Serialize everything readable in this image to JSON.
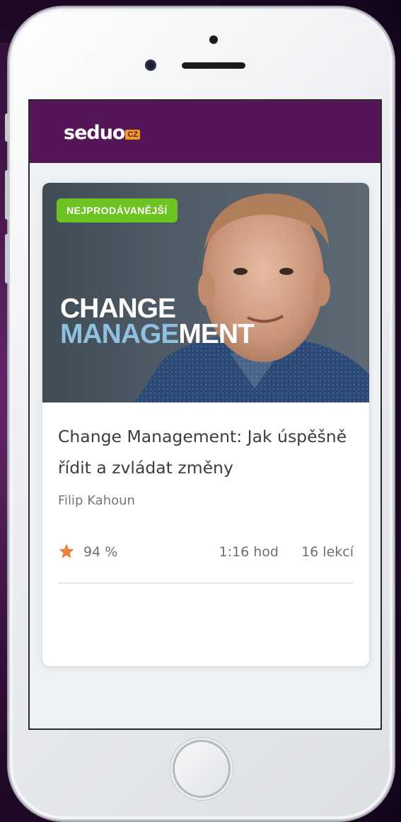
{
  "brand": {
    "logo_text": "seduo",
    "logo_badge": "CZ",
    "color": "#541656",
    "badge_color": "#f39a1d"
  },
  "course": {
    "badge": "NEJPRODÁVANĚJŠÍ",
    "badge_color": "#6cc321",
    "image_title_line1": "CHANGE",
    "image_title_line2_blue": "MANAGE",
    "image_title_line2_white": "MENT",
    "title": "Change Management: Jak úspěšně řídit a zvládat změny",
    "author": "Filip Kahoun",
    "rating": "94 %",
    "rating_icon": "star-icon",
    "star_color": "#e8843a",
    "duration": "1:16 hod",
    "lessons": "16 lekcí"
  }
}
